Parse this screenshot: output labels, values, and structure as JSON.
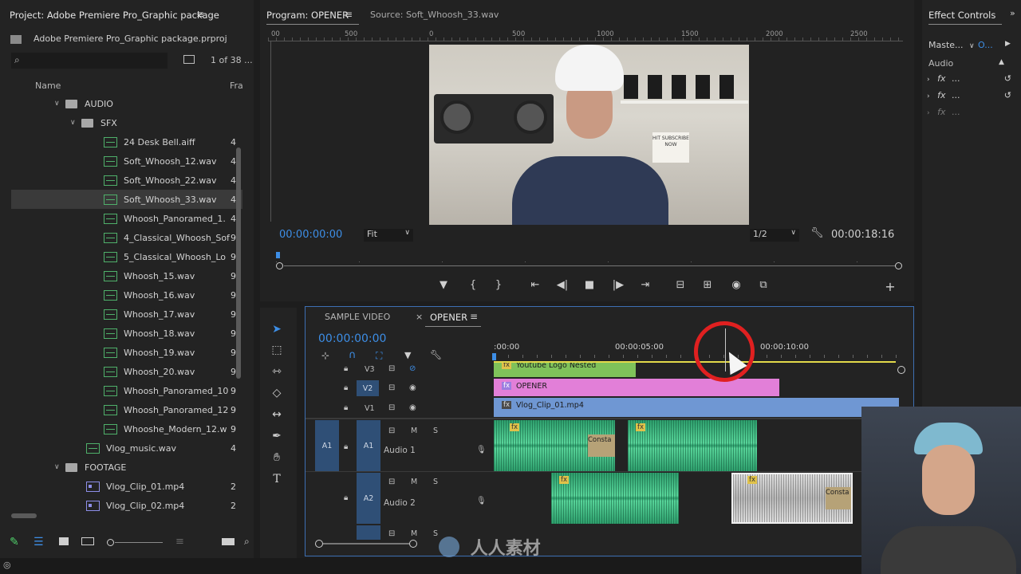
{
  "project_panel": {
    "title": "Project: Adobe Premiere Pro_Graphic package",
    "file_name": "Adobe Premiere Pro_Graphic package.prproj",
    "count": "1 of 38 ...",
    "col_name": "Name",
    "col_fra": "Fra",
    "items": [
      {
        "label": "AUDIO",
        "type": "folder"
      },
      {
        "label": "SFX",
        "type": "folder"
      },
      {
        "label": "24 Desk Bell.aiff",
        "type": "audio",
        "rate": "4"
      },
      {
        "label": "Soft_Whoosh_12.wav",
        "type": "audio",
        "rate": "4"
      },
      {
        "label": "Soft_Whoosh_22.wav",
        "type": "audio",
        "rate": "4"
      },
      {
        "label": "Soft_Whoosh_33.wav",
        "type": "audio",
        "rate": "4"
      },
      {
        "label": "Whoosh_Panoramed_1.",
        "type": "audio",
        "rate": "4"
      },
      {
        "label": "4_Classical_Whoosh_Sof",
        "type": "audio",
        "rate": "9"
      },
      {
        "label": "5_Classical_Whoosh_Lo",
        "type": "audio",
        "rate": "9"
      },
      {
        "label": "Whoosh_15.wav",
        "type": "audio",
        "rate": "9"
      },
      {
        "label": "Whoosh_16.wav",
        "type": "audio",
        "rate": "9"
      },
      {
        "label": "Whoosh_17.wav",
        "type": "audio",
        "rate": "9"
      },
      {
        "label": "Whoosh_18.wav",
        "type": "audio",
        "rate": "9"
      },
      {
        "label": "Whoosh_19.wav",
        "type": "audio",
        "rate": "9"
      },
      {
        "label": "Whoosh_20.wav",
        "type": "audio",
        "rate": "9"
      },
      {
        "label": "Whoosh_Panoramed_10",
        "type": "audio",
        "rate": "9"
      },
      {
        "label": "Whoosh_Panoramed_12",
        "type": "audio",
        "rate": "9"
      },
      {
        "label": "Whooshe_Modern_12.w",
        "type": "audio",
        "rate": "9"
      },
      {
        "label": "Vlog_music.wav",
        "type": "audio",
        "rate": "4"
      },
      {
        "label": "FOOTAGE",
        "type": "folder"
      },
      {
        "label": "Vlog_Clip_01.mp4",
        "type": "video",
        "rate": "2"
      },
      {
        "label": "Vlog_Clip_02.mp4",
        "type": "video",
        "rate": "2"
      }
    ]
  },
  "program_monitor": {
    "tab_program": "Program: OPENER",
    "tab_source": "Source: Soft_Whoosh_33.wav",
    "ruler_ticks": [
      "00",
      "500",
      "0",
      "500",
      "1000",
      "1500",
      "2000",
      "2500"
    ],
    "timecode_current": "00:00:00:00",
    "fit": "Fit",
    "resolution": "1/2",
    "timecode_duration": "00:00:18:16",
    "sign_text": "HIT SUBSCRIBE NOW"
  },
  "effect_controls": {
    "title": "Effect Controls",
    "master": "Maste...",
    "clip": "O...",
    "section_audio": "Audio",
    "fx_rows": [
      "...",
      "...",
      "..."
    ]
  },
  "timeline": {
    "tab_sample": "SAMPLE VIDEO",
    "tab_opener": "OPENER",
    "timecode": "00:00:00:00",
    "ruler": [
      ":00:00",
      "00:00:05:00",
      "00:00:10:00"
    ],
    "tracks": {
      "v3": "V3",
      "v2": "V2",
      "v1": "V1",
      "a1": "A1",
      "a2": "A2",
      "audio1": "Audio 1",
      "audio2": "Audio 2",
      "m": "M",
      "s": "S"
    },
    "clips": {
      "youtube": "Youtube Logo Nested",
      "opener": "OPENER",
      "vlog": "Vlog_Clip_01.mp4",
      "constant": "Consta",
      "fx": "fx"
    }
  },
  "watermark": "人人素材"
}
